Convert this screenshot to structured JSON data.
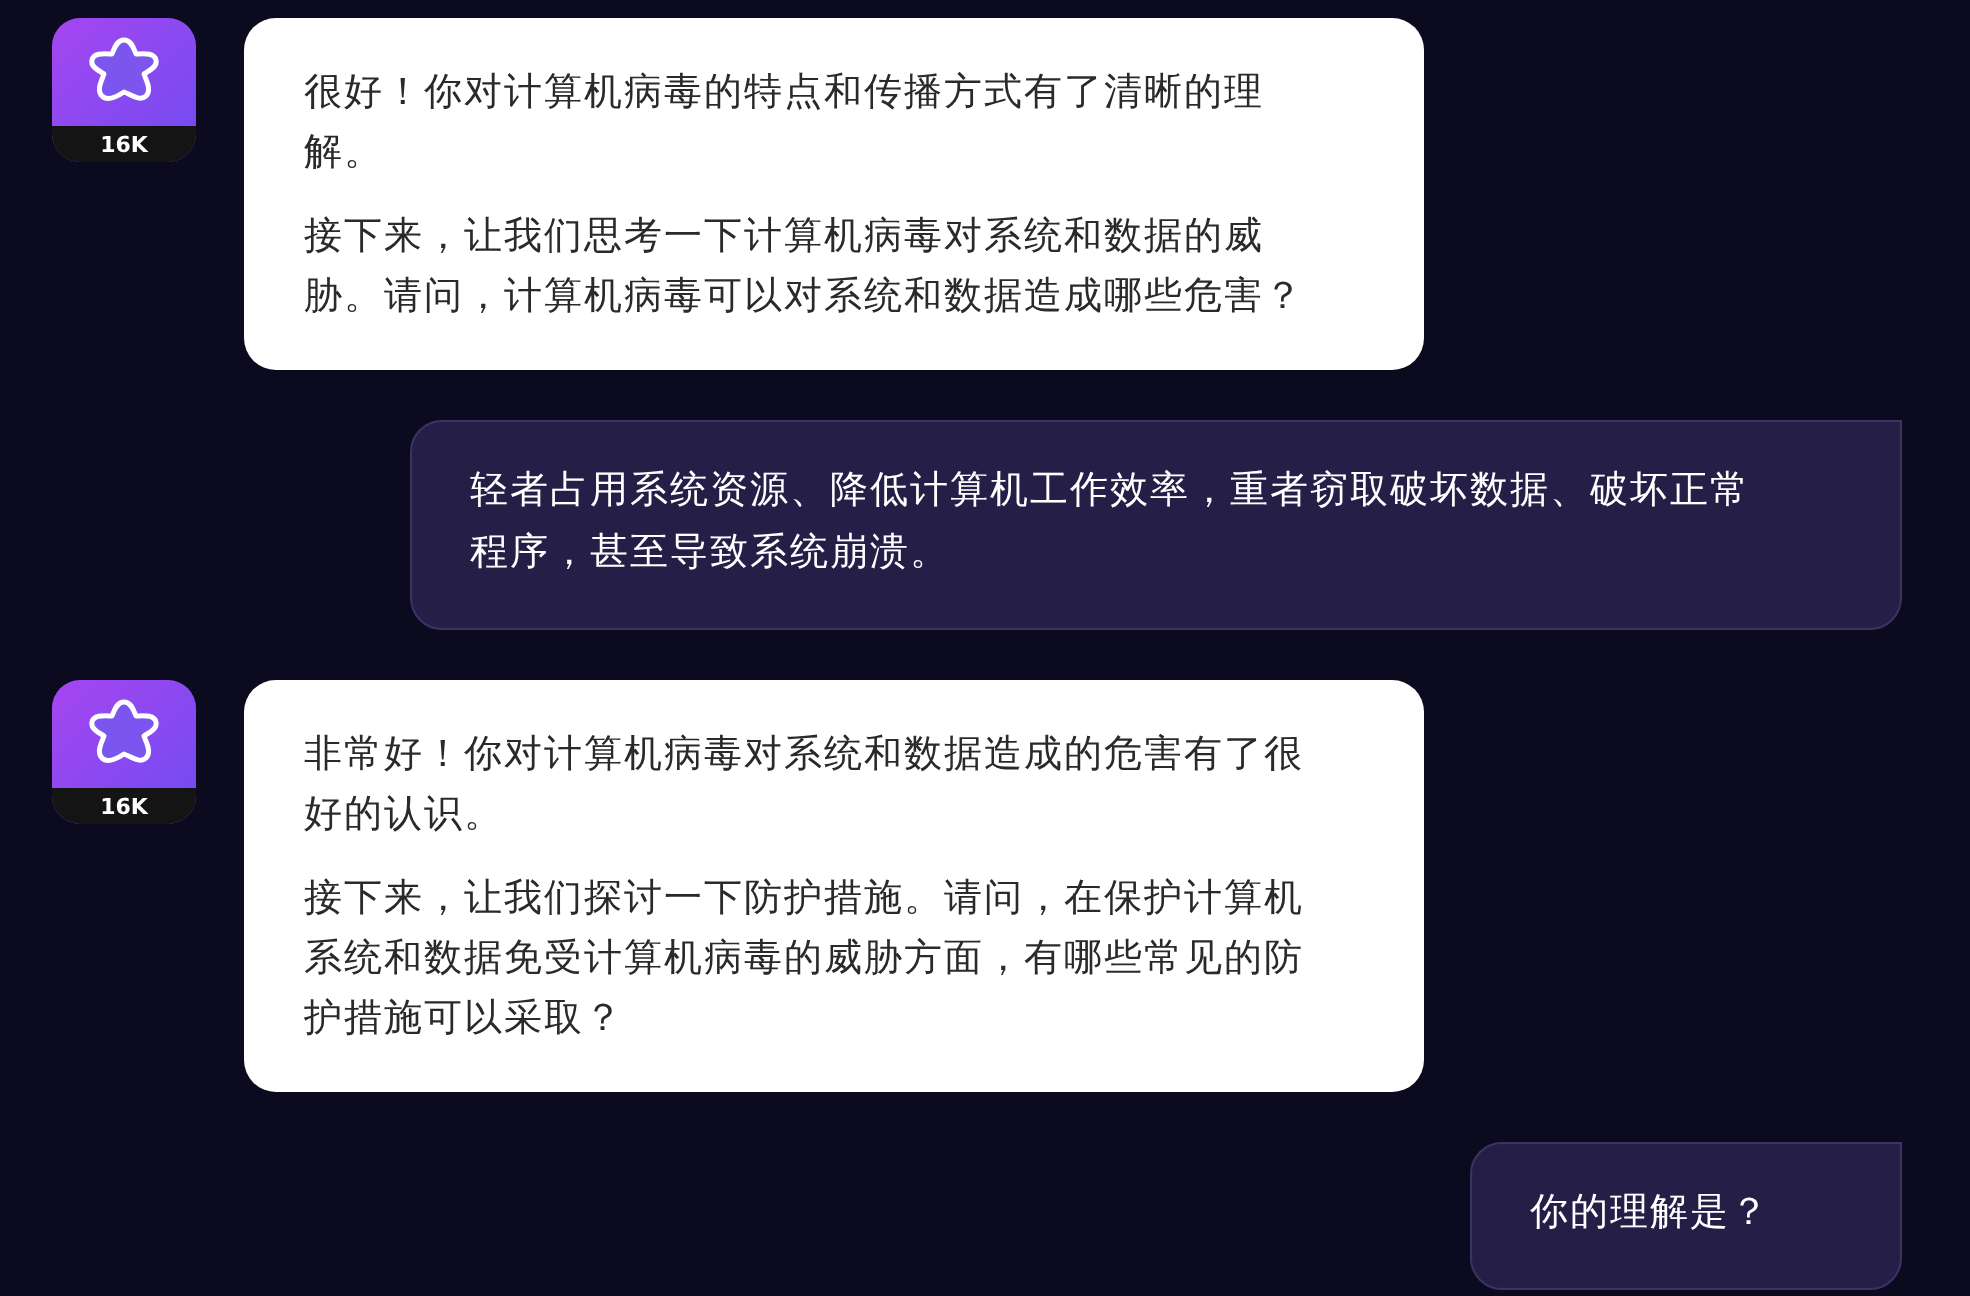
{
  "messages": [
    {
      "kind": "bot",
      "avatar_badge": "16K",
      "paragraphs": [
        "很好！你对计算机病毒的特点和传播方式有了清晰的理解。",
        "接下来，让我们思考一下计算机病毒对系统和数据的威胁。请问，计算机病毒可以对系统和数据造成哪些危害？"
      ]
    },
    {
      "kind": "user",
      "text": "轻者占用系统资源、降低计算机工作效率，重者窃取破坏数据、破坏正常程序，甚至导致系统崩溃。"
    },
    {
      "kind": "bot",
      "avatar_badge": "16K",
      "paragraphs": [
        "非常好！你对计算机病毒对系统和数据造成的危害有了很好的认识。",
        "接下来，让我们探讨一下防护措施。请问，在保护计算机系统和数据免受计算机病毒的威胁方面，有哪些常见的防护措施可以采取？"
      ]
    },
    {
      "kind": "user",
      "text": "你的理解是？"
    }
  ]
}
